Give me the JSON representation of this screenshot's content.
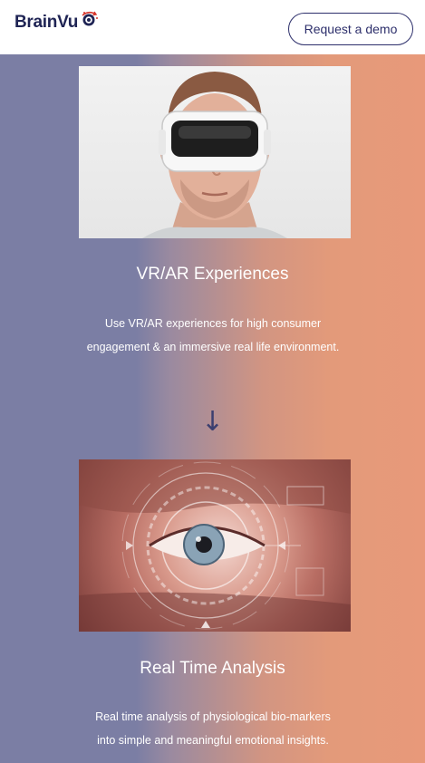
{
  "header": {
    "logo_text": "BrainVu",
    "demo_button": "Request a demo"
  },
  "features": [
    {
      "image_icon": "vr-headset-man-image",
      "title": "VR/AR Experiences",
      "description": "Use VR/AR experiences for high consumer engagement & an immersive real life environment."
    },
    {
      "image_icon": "eye-hud-analysis-image",
      "title": "Real Time Analysis",
      "description": "Real time analysis of physiological bio-markers into simple and meaningful emotional insights."
    }
  ],
  "arrow_icon": "↓",
  "colors": {
    "brand_navy": "#1f2454",
    "accent_red": "#d6342a",
    "gradient_left": "#7b7ea4",
    "gradient_right": "#e8997a"
  }
}
